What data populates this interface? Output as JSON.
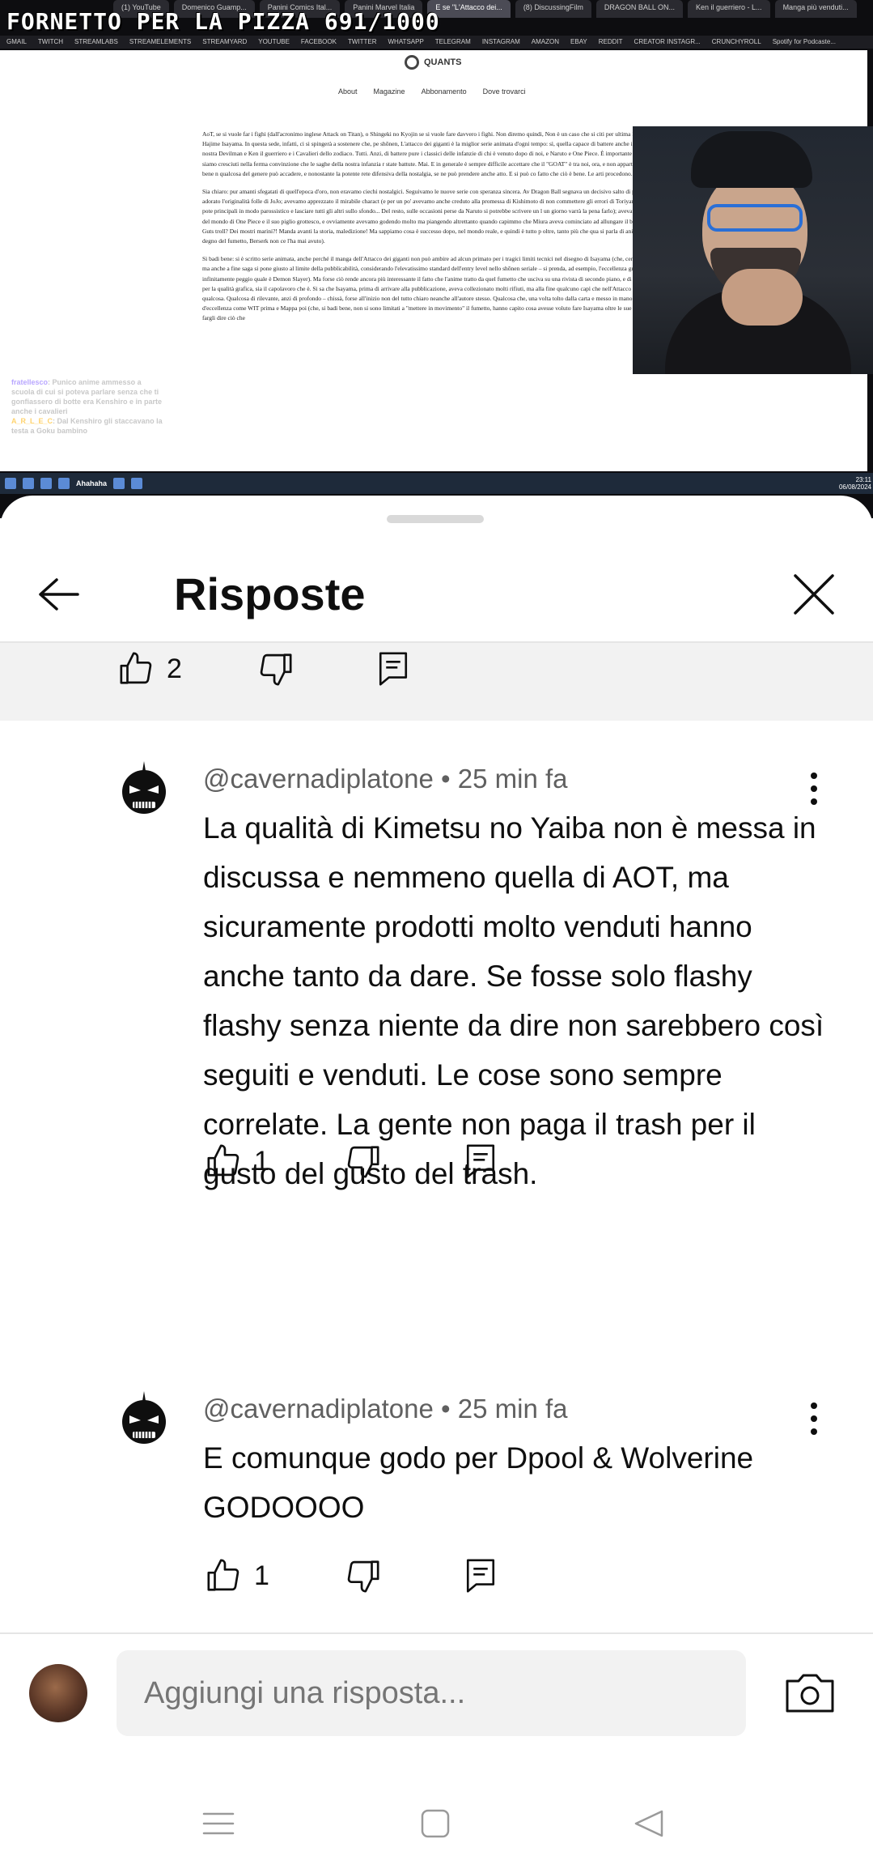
{
  "stream": {
    "title": "FORNETTO PER LA PIZZA 691/1000",
    "browser_tabs": [
      "(1) YouTube",
      "Domenico Guamp...",
      "Panini Comics Ital...",
      "Panini Marvel Italia",
      "E se \"L'Attacco dei...",
      "(8) DiscussingFilm",
      "DRAGON BALL ON...",
      "Ken il guerriero - L...",
      "Manga più venduti..."
    ],
    "bookmarks": [
      "GMAIL",
      "TWITCH",
      "STREAMLABS",
      "STREAMELEMENTS",
      "STREAMYARD",
      "YOUTUBE",
      "FACEBOOK",
      "TWITTER",
      "WHATSAPP",
      "TELEGRAM",
      "INSTAGRAM",
      "AMAZON",
      "EBAY",
      "REDDIT",
      "CREATOR INSTAGR...",
      "CRUNCHYROLL",
      "Spotify for Podcaste..."
    ],
    "site_name": "QUANTS",
    "site_nav": [
      "About",
      "Magazine",
      "Abbonamento",
      "Dove trovarci"
    ],
    "article_paragraphs": [
      "AoT, se si vuole far i fighi (dall'acronimo inglese Attack on Titan), o Shingeki no Kyojin se si vuole fare davvero i fighi. Non diremo quindi, Non è un caso che si citi per ultima la serie tratta dall'opera di Hajime Isayama. In questa sede, infatti, ci si spingerà a sostenere che, pe shōnen, L'attacco dei giganti è la miglior serie animata d'ogni tempo: sì, quella capace di battere anche i classici immortali della nostra Devilman e Ken il guerriero e i Cavalieri dello zodiaco. Tutti. Anzi, di battere pure i classici delle infanzie di chi è venuto dopo di noi, e Naruto e One Piece. È importante farlo, crediamo, perché siamo cresciuti nella ferma convinzione che le saghe della nostra infanzia r state battute. Mai. E in generale è sempre difficile accettare che il \"GOAT\" è tra noi, ora, e non appartiene al passato: lo si vede bene n qualcosa del genere può accadere, e nonostante la potente rete difensiva della nostalgia, se ne può prendere anche atto. E si può co fatto che ciò è bene. Le arti procedono. Si va avanti.",
      "Sia chiaro: pur amanti sfegatati di quell'epoca d'oro, non eravamo ciechi nostalgici. Seguivamo le nuove serie con speranza sincera. Av Dragon Ball segnava un decisivo salto di paradigma; avevamo adorato l'originalità folle di JoJo; avevamo apprezzato il mirabile charact (e per un po' avevamo anche creduto alla promessa di Kishimoto di non commettere gli errori di Toriyama, finendo a esagerare il pote principali in modo parossistico e lasciare tutti gli altri sullo sfondo... Del resto, sulle occasioni perse da Naruto si potrebbe scrivere un l un giorno varrà la pena farlo); avevamo apprezzato la vastità del mondo di One Piece e il suo piglio grottesco, e ovviamente avevamo godendo molto ma piangendo altrettanto quando capimmo che Miura aveva cominciato ad allungare il brodo (cosa ci fai vedere Guts troll? Dei mostri marini?! Manda avanti la storia, maledizione! Ma sappiamo cosa è successo dopo, nel mondo reale, e quindi è tutto p oltre, tanto più che qua si parla di anime, e un anime davvero degno del fumetto, Berserk non ce l'ha mai avuto).",
      "Si badi bene: si è scritto serie animata, anche perché il manga dell'Attacco dei giganti non può ambire ad alcun primato per i tragici limiti tecnici nel disegno di Isayama (che, certo, va poi a migliorare, ma anche a fine saga si pone giusto al limite della pubblicabilità, considerando l'elevatissimo standard dell'entry level nello shōnen seriale – si prenda, ad esempio, l'eccellenza grafica di un lavoro scritto infinitamente peggio quale è Demon Slayer). Ma forse ciò rende ancora più interessante il fatto che l'anime tratto da quel fumetto che usciva su una rivista di secondo piano, e di certo non si faceva notare per la qualità grafica, sia il capolavoro che è. Si sa che Isayama, prima di arrivare alla pubblicazione, aveva collezionato molti rifiuti, ma alla fine qualcuno capì che nell'Attacco dei giganti si annidava qualcosa. Qualcosa di rilevante, anzi di profondo – chissà, forse all'inizio non del tutto chiaro neanche all'autore stesso. Qualcosa che, una volta tolto dalla carta e messo in mano a studi d'animazione d'eccellenza come WIT prima e Mappa poi (che, si badi bene, non si sono limitati a \"mettere in movimento\" il fumetto, hanno capito cosa avesse voluto fare Isayama oltre le sue capacità tecniche per fargli dire ciò che"
    ],
    "chat": [
      {
        "user": "fratellesco",
        "text": "Punico anime ammesso a scuola di cui si poteva parlare senza che ti gonfiassero di botte era Kenshiro e in parte anche i cavalieri"
      },
      {
        "user": "A_R_L_E_C",
        "text": "Dal Kenshiro gli staccavano la testa a Goku bambino"
      }
    ],
    "taskbar_label": "Ahahaha",
    "clock_time": "23:11",
    "clock_date": "06/08/2024"
  },
  "sheet": {
    "title": "Risposte"
  },
  "parent_comment": {
    "like_count": "2"
  },
  "replies": [
    {
      "author": "@cavernadiplatone",
      "time": "25 min fa",
      "text": "La qualità di Kimetsu no Yaiba non è messa in discussa e nemmeno quella di AOT, ma sicuramente prodotti molto venduti hanno anche tanto da dare. Se fosse solo flashy flashy senza niente da dire non sarebbero così seguiti e venduti. Le cose sono sempre correlate. La gente non paga il trash per il gusto del gusto del trash.",
      "like_count": "1"
    },
    {
      "author": "@cavernadiplatone",
      "time": "25 min fa",
      "text": "E comunque godo per Dpool & Wolverine GODOOOO",
      "like_count": "1"
    }
  ],
  "composer": {
    "placeholder": "Aggiungi una risposta..."
  },
  "icons": {
    "back": "arrow-left-icon",
    "close": "close-icon",
    "like": "thumb-up-icon",
    "dislike": "thumb-down-icon",
    "reply": "comment-reply-icon",
    "more": "more-vertical-icon",
    "camera": "camera-icon"
  },
  "colors": {
    "text_primary": "#0f0f0f",
    "text_secondary": "#606060",
    "surface": "#f2f2f2"
  }
}
